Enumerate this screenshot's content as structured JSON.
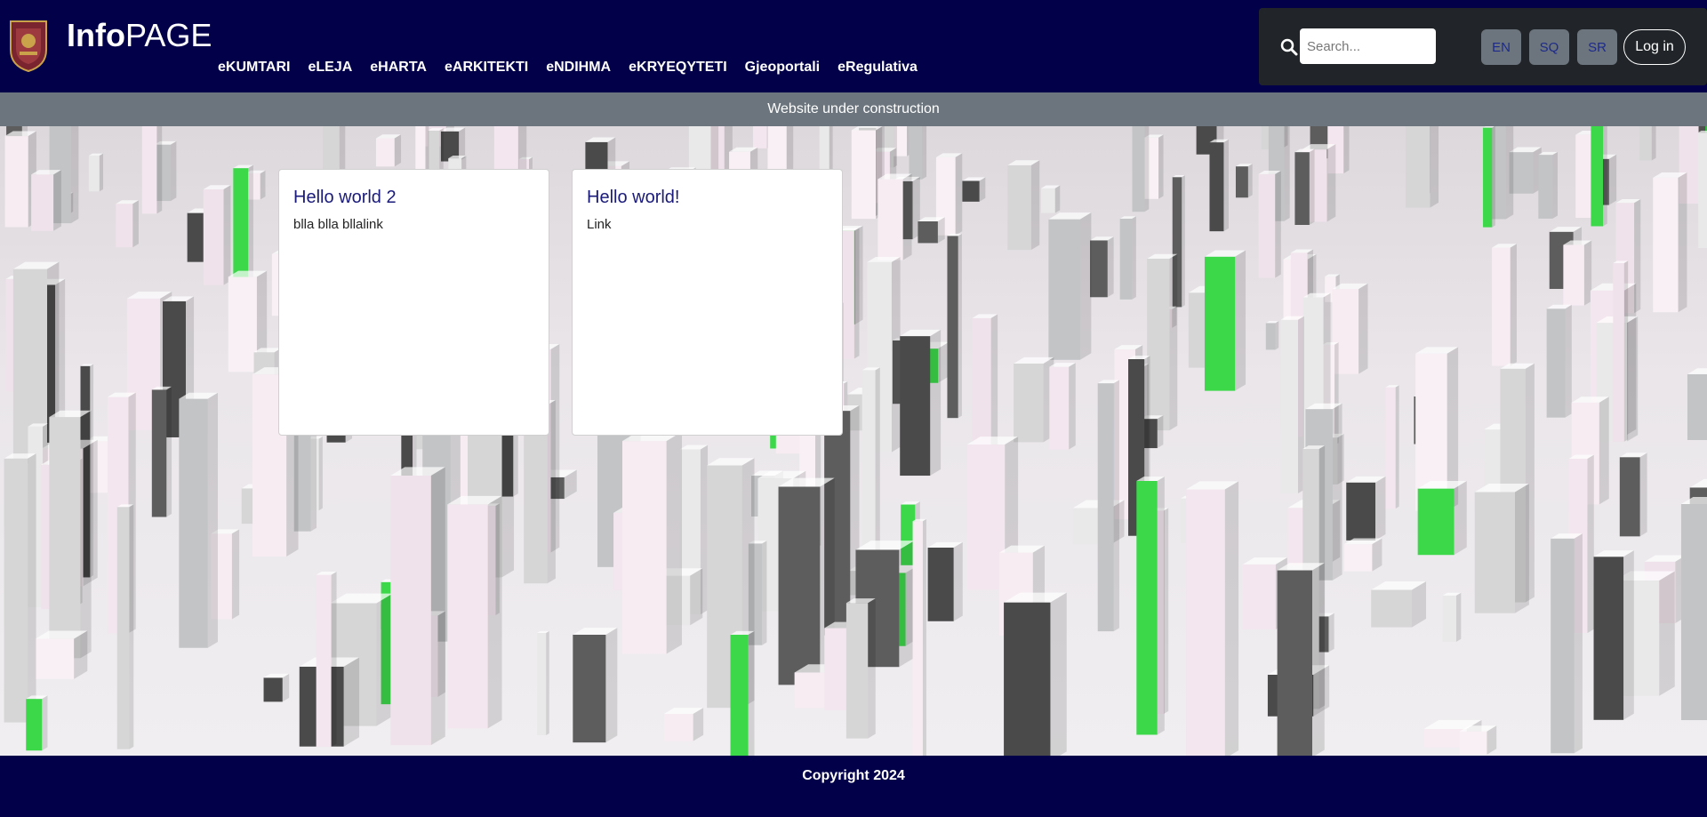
{
  "header": {
    "brand_bold": "Info",
    "brand_rest": "PAGE",
    "nav": [
      "eKUMTARI",
      "eLEJA",
      "eHARTA",
      "eARKITEKTI",
      "eNDIHMA",
      "eKRYEQYTETI",
      "Gjeoportali",
      "eRegulativa"
    ]
  },
  "toolbar": {
    "search_placeholder": "Search...",
    "languages": [
      "EN",
      "SQ",
      "SR"
    ],
    "login_label": "Log in"
  },
  "banner": {
    "text": "Website under construction"
  },
  "cards": [
    {
      "title": "Hello world 2",
      "text": "blla blla bllalink"
    },
    {
      "title": "Hello world!",
      "text": "Link"
    }
  ],
  "footer": {
    "text": "Copyright 2024"
  },
  "colors": {
    "nav_bg": "#03004a",
    "toolbar_bg": "#212529",
    "banner_bg": "#6c757d",
    "card_title": "#1a1a7a"
  }
}
